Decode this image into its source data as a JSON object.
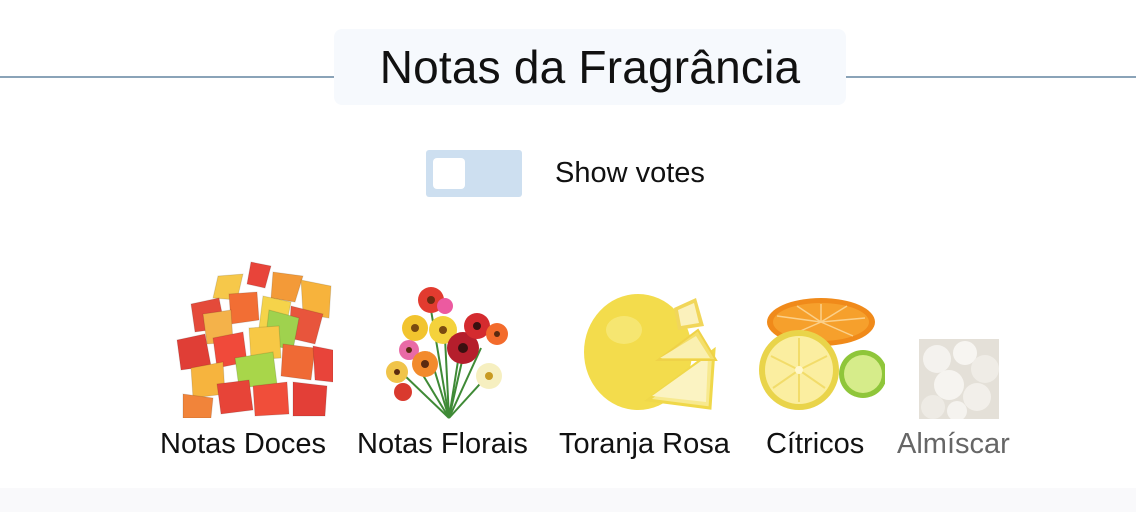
{
  "section": {
    "title": "Notas da Fragrância"
  },
  "votes_toggle": {
    "label": "Show votes",
    "checked": false
  },
  "notes": [
    {
      "name": "Notas Doces",
      "icon": "candy-icon",
      "muted": false
    },
    {
      "name": "Notas Florais",
      "icon": "flowers-icon",
      "muted": false
    },
    {
      "name": "Toranja Rosa",
      "icon": "grapefruit-icon",
      "muted": false
    },
    {
      "name": "Cítricos",
      "icon": "citrus-icon",
      "muted": false
    },
    {
      "name": "Almíscar",
      "icon": "musk-icon",
      "muted": true
    }
  ],
  "colors": {
    "divider": "#8aa3b8",
    "title_bg": "#f6f9fd",
    "toggle_bg": "#cddff0",
    "muted_text": "#666666"
  }
}
